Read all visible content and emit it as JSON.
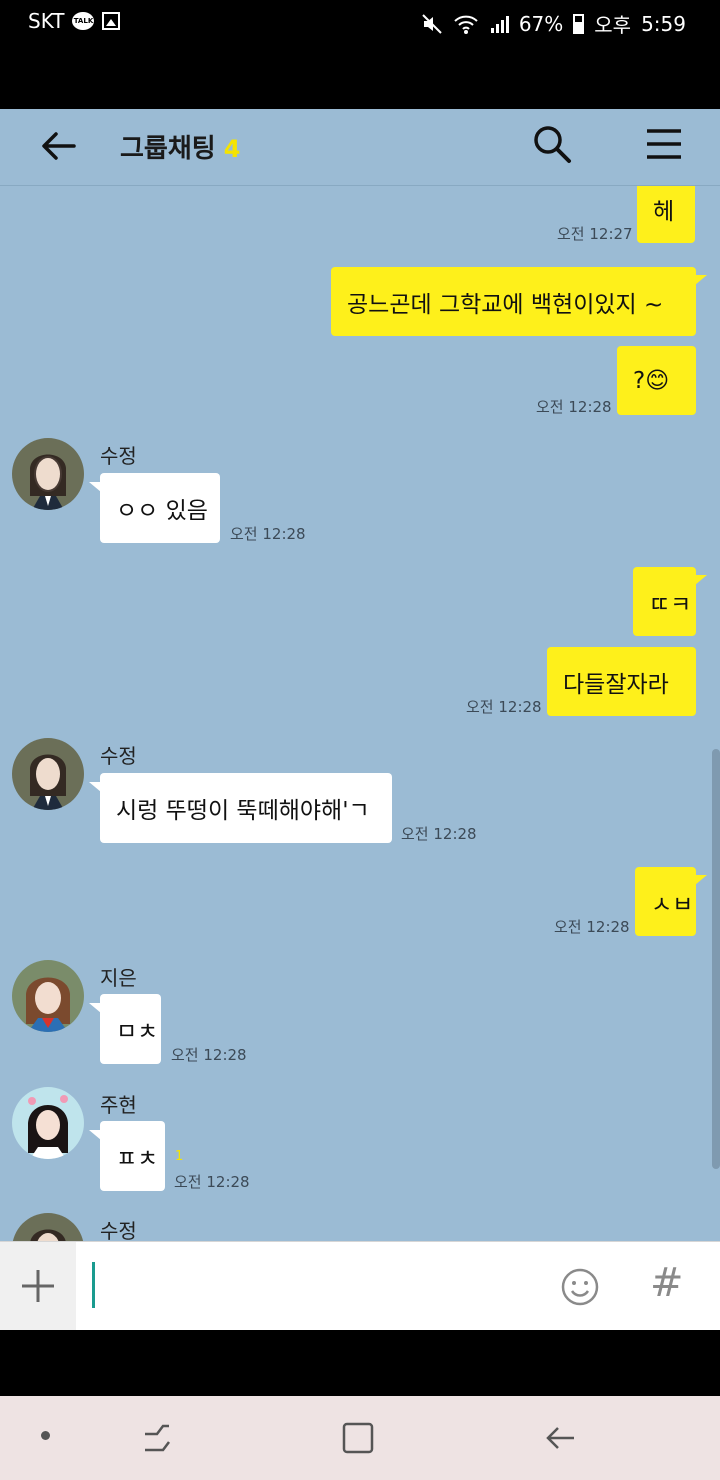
{
  "status_bar": {
    "carrier": "SKT",
    "talk_badge": "TALK",
    "battery": "67%",
    "ampm": "오후",
    "time": "5:59"
  },
  "header": {
    "title": "그룹채팅",
    "member_count": "4"
  },
  "messages": [
    {
      "type": "me",
      "text": "헤",
      "time": "오전 12:27"
    },
    {
      "type": "me",
      "text": "공느곤데 그학교에 백현이있지 ~"
    },
    {
      "type": "me",
      "text": "?😊",
      "time": "오전 12:28"
    },
    {
      "type": "other",
      "sender": "수정",
      "text": "ㅇㅇ 있음",
      "time": "오전 12:28"
    },
    {
      "type": "me",
      "text": "ㄸㅋ"
    },
    {
      "type": "me",
      "text": "다들잘자라",
      "time": "오전 12:28"
    },
    {
      "type": "other",
      "sender": "수정",
      "text": "시렁 뚜떵이 뚝떼해야해'ㄱ",
      "time": "오전 12:28"
    },
    {
      "type": "me",
      "text": "ㅅㅂ",
      "time": "오전 12:28"
    },
    {
      "type": "other",
      "sender": "지은",
      "text": "ㅁㅊ",
      "time": "오전 12:28"
    },
    {
      "type": "other",
      "sender": "주현",
      "text": "ㅍㅊ",
      "time": "오전 12:28",
      "unread": "1"
    },
    {
      "type": "other",
      "sender": "수정"
    }
  ],
  "input": {
    "placeholder": ""
  },
  "colors": {
    "chat_bg": "#9bbbd4",
    "my_bubble": "#fef01b",
    "other_bubble": "#ffffff",
    "count_accent": "#f5e400"
  },
  "icons": [
    "back-arrow-icon",
    "search-icon",
    "menu-icon",
    "plus-icon",
    "emoji-icon",
    "hash-icon"
  ]
}
